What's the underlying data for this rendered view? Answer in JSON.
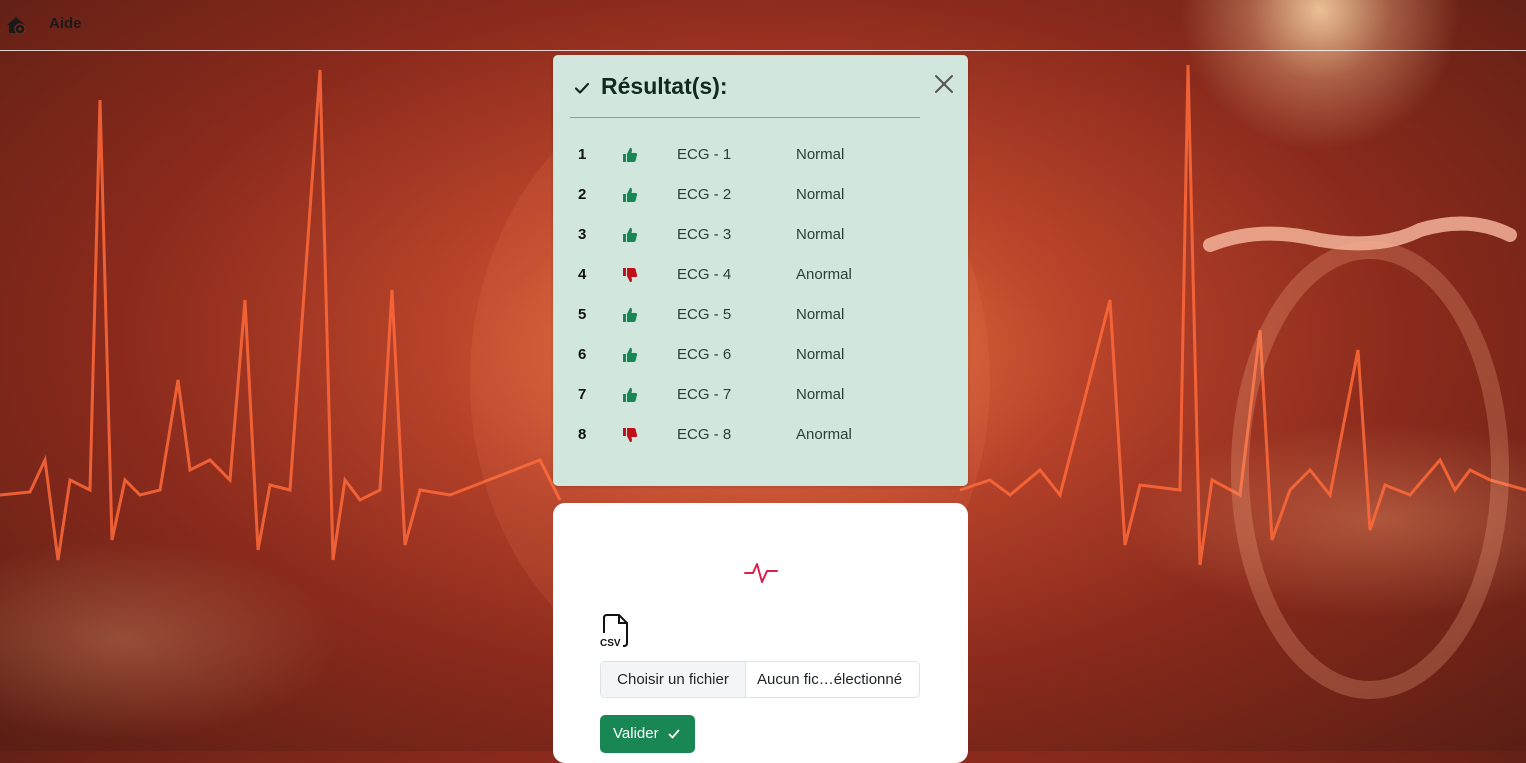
{
  "navbar": {
    "home_icon": "house-gear-icon",
    "help_label": "Aide"
  },
  "results": {
    "title": "Résultat(s):",
    "title_icon": "check-icon",
    "close_icon": "close-icon",
    "items": [
      {
        "index": "1",
        "name": "ECG - 1",
        "status": "Normal",
        "icon": "thumbs-up-icon"
      },
      {
        "index": "2",
        "name": "ECG - 2",
        "status": "Normal",
        "icon": "thumbs-up-icon"
      },
      {
        "index": "3",
        "name": "ECG - 3",
        "status": "Normal",
        "icon": "thumbs-up-icon"
      },
      {
        "index": "4",
        "name": "ECG - 4",
        "status": "Anormal",
        "icon": "thumbs-down-icon"
      },
      {
        "index": "5",
        "name": "ECG - 5",
        "status": "Normal",
        "icon": "thumbs-up-icon"
      },
      {
        "index": "6",
        "name": "ECG - 6",
        "status": "Normal",
        "icon": "thumbs-up-icon"
      },
      {
        "index": "7",
        "name": "ECG - 7",
        "status": "Normal",
        "icon": "thumbs-up-icon"
      },
      {
        "index": "8",
        "name": "ECG - 8",
        "status": "Anormal",
        "icon": "thumbs-down-icon"
      }
    ]
  },
  "upload": {
    "pulse_icon": "activity-pulse-icon",
    "file_type_icon": "csv-file-icon",
    "choose_file_label": "Choisir un fichier",
    "file_name_label": "Aucun fic…électionné",
    "submit_label": "Valider",
    "submit_icon": "check-icon"
  },
  "colors": {
    "result_panel": "#d1e7dd",
    "normal": "#198754",
    "abnormal": "#c0101a",
    "submit_button": "#198754",
    "pulse": "#dc1f4a"
  }
}
